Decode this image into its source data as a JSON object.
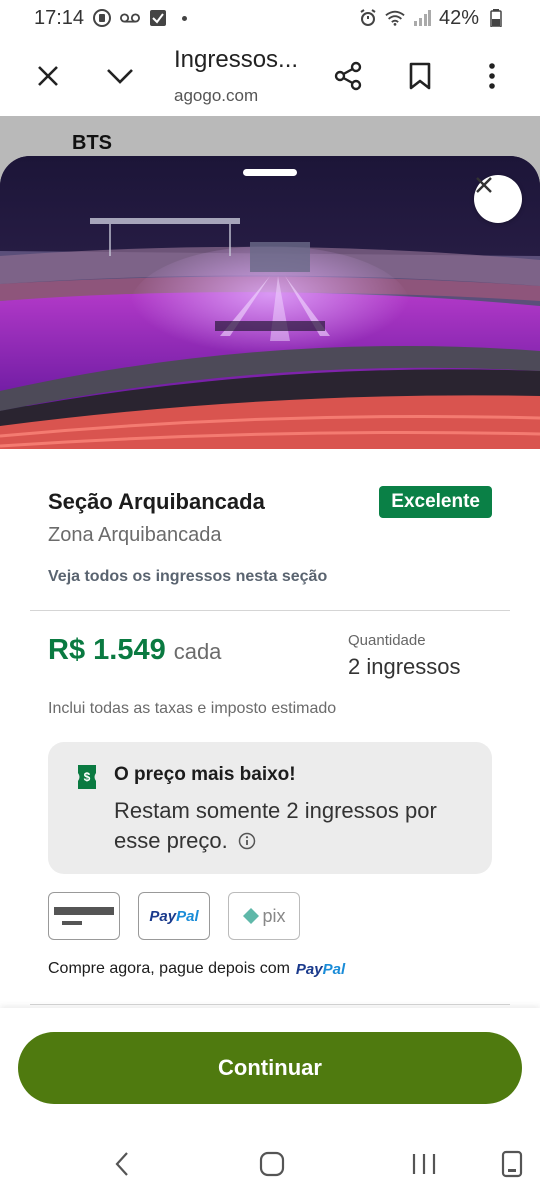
{
  "status_bar": {
    "time": "17:14",
    "battery": "42%"
  },
  "browser": {
    "title": "Ingressos...",
    "url": "agogo.com"
  },
  "background_page": {
    "heading": "BTS"
  },
  "sheet": {
    "section_title": "Seção Arquibancada",
    "rating_badge": "Excelente",
    "zone": "Zona Arquibancada",
    "see_all_link": "Veja todos os ingressos nesta seção",
    "price": "R$ 1.549",
    "price_unit": "cada",
    "quantity_label": "Quantidade",
    "quantity_value": "2 ingressos",
    "taxes_note": "Inclui todas as taxas e imposto estimado",
    "promo": {
      "title": "O preço mais baixo!",
      "body": "Restam somente 2 ingressos por esse preço."
    },
    "payment_methods": [
      "card-icon",
      "paypal-logo",
      "pix-logo"
    ],
    "paypal_label": "PayPal",
    "pix_label": "pix",
    "bnpl_text": "Compre agora, pague depois com",
    "continue_label": "Continuar"
  },
  "colors": {
    "brand_green": "#0a7a41",
    "badge_green": "#0a8046",
    "button_green": "#4f7a0f"
  }
}
